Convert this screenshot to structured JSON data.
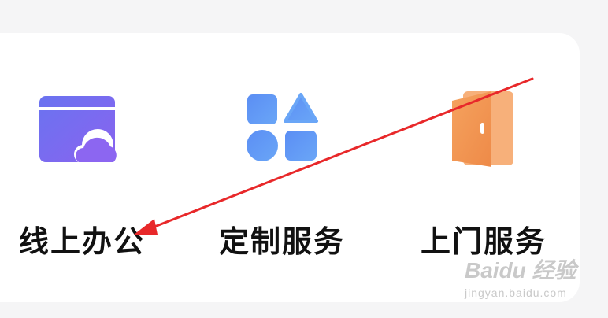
{
  "services": [
    {
      "label": "线上办公",
      "icon": "cloud-window-icon",
      "color": "#7467f0"
    },
    {
      "label": "定制服务",
      "icon": "shapes-grid-icon",
      "color": "#5b93f5"
    },
    {
      "label": "上门服务",
      "icon": "door-icon",
      "color": "#f08d4a"
    }
  ],
  "annotation": {
    "arrow_color": "#e8282a",
    "arrow_target": "线上办公"
  },
  "watermark": {
    "brand": "Baidu 经验",
    "url": "jingyan.baidu.com"
  }
}
